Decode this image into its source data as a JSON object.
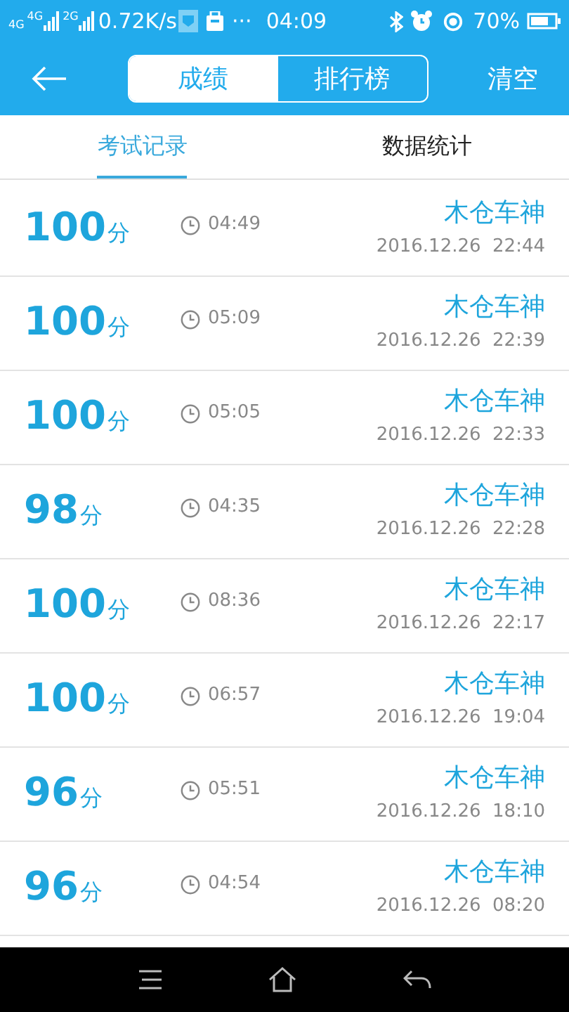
{
  "status_bar": {
    "network_labels": [
      "4G",
      "4G",
      "2G"
    ],
    "speed": "0.72K/s",
    "more": "···",
    "time": "04:09",
    "battery": "70%"
  },
  "header": {
    "segments": [
      {
        "label": "成绩",
        "selected": true
      },
      {
        "label": "排行榜",
        "selected": false
      }
    ],
    "action": "清空"
  },
  "tabs": [
    {
      "label": "考试记录",
      "selected": true
    },
    {
      "label": "数据统计",
      "selected": false
    }
  ],
  "records": [
    {
      "score": "100",
      "unit": "分",
      "duration": "04:49",
      "name": "木仓车神",
      "date": "2016.12.26  22:44"
    },
    {
      "score": "100",
      "unit": "分",
      "duration": "05:09",
      "name": "木仓车神",
      "date": "2016.12.26  22:39"
    },
    {
      "score": "100",
      "unit": "分",
      "duration": "05:05",
      "name": "木仓车神",
      "date": "2016.12.26  22:33"
    },
    {
      "score": "98",
      "unit": "分",
      "duration": "04:35",
      "name": "木仓车神",
      "date": "2016.12.26  22:28"
    },
    {
      "score": "100",
      "unit": "分",
      "duration": "08:36",
      "name": "木仓车神",
      "date": "2016.12.26  22:17"
    },
    {
      "score": "100",
      "unit": "分",
      "duration": "06:57",
      "name": "木仓车神",
      "date": "2016.12.26  19:04"
    },
    {
      "score": "96",
      "unit": "分",
      "duration": "05:51",
      "name": "木仓车神",
      "date": "2016.12.26  18:10"
    },
    {
      "score": "96",
      "unit": "分",
      "duration": "04:54",
      "name": "木仓车神",
      "date": "2016.12.26  08:20"
    }
  ]
}
